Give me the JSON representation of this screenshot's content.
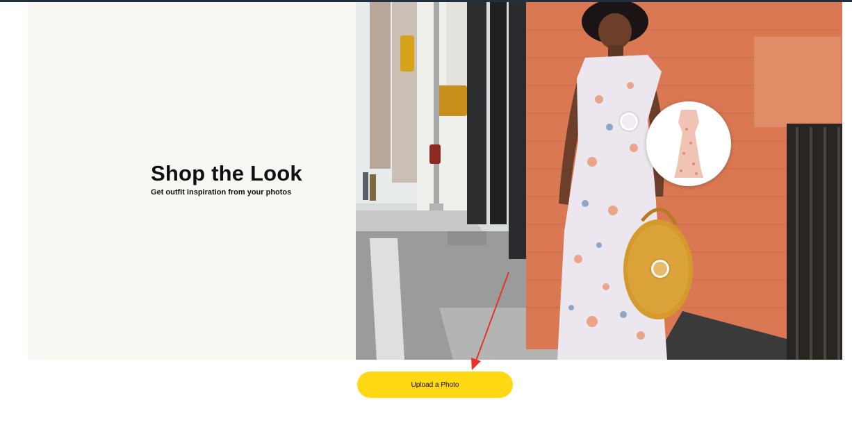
{
  "hero": {
    "title": "Shop the Look",
    "subtitle": "Get outfit inspiration from your photos"
  },
  "actions": {
    "upload_label": "Upload a Photo"
  },
  "colors": {
    "top_bar": "#232f3e",
    "panel_bg": "#f8f7f4",
    "button_bg": "#ffd814",
    "brick": "#d97852",
    "annotation_arrow": "#e8312a"
  },
  "icons": [
    "hotspot-dress",
    "hotspot-bag",
    "annotation-arrow"
  ]
}
